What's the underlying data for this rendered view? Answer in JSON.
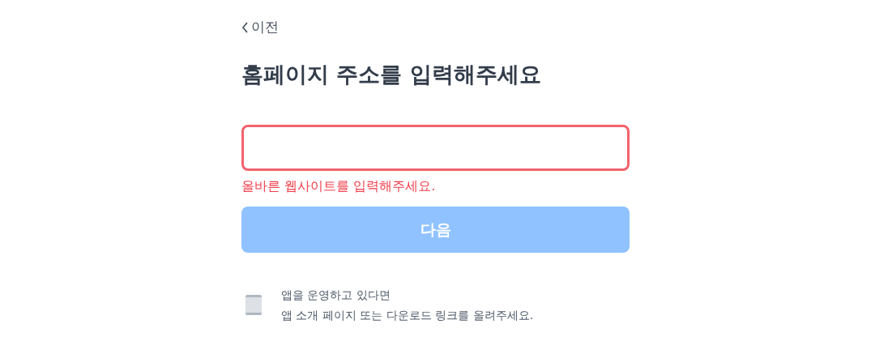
{
  "back": {
    "label": "이전"
  },
  "title": "홈페이지 주소를 입력해주세요",
  "url_field": {
    "error": true,
    "error_message": "올바른 웹사이트를 입력해주세요."
  },
  "next_button": {
    "label": "다음",
    "disabled": true
  },
  "tip": {
    "heading": "앱을 운영하고 있다면",
    "text": "앱 소개 페이지 또는 다운로드 링크를 올려주세요."
  }
}
